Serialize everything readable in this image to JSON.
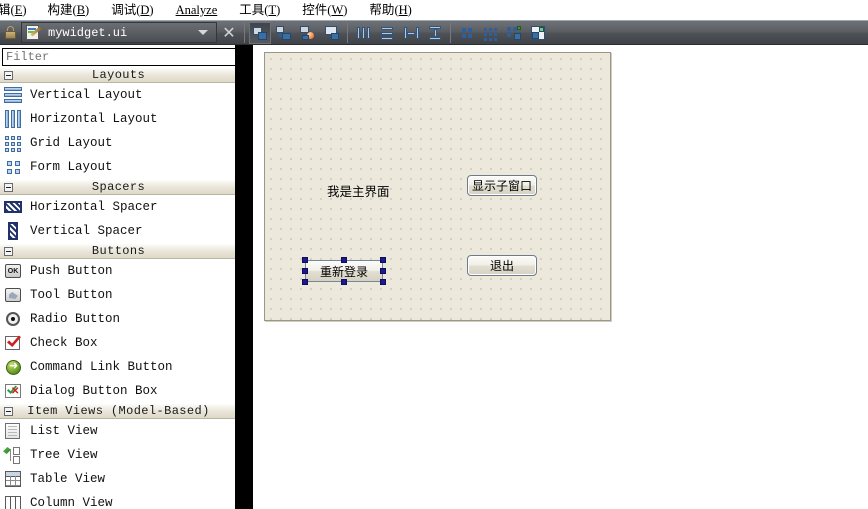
{
  "menu": {
    "items": [
      {
        "label": "辑",
        "mnemonic": "E",
        "name": "menu-edit"
      },
      {
        "label": "构建",
        "mnemonic": "B",
        "name": "menu-build"
      },
      {
        "label": "调试",
        "mnemonic": "D",
        "name": "menu-debug"
      },
      {
        "label": "Analyze",
        "mnemonic": "",
        "name": "menu-analyze"
      },
      {
        "label": "工具",
        "mnemonic": "T",
        "name": "menu-tools"
      },
      {
        "label": "控件",
        "mnemonic": "W",
        "name": "menu-widgets"
      },
      {
        "label": "帮助",
        "mnemonic": "H",
        "name": "menu-help"
      }
    ]
  },
  "toolbar": {
    "lock_icon": "lock-icon",
    "file_name": "mywidget.ui",
    "file_icon": "ui-file-icon",
    "dropdown_icon": "chevron-down-icon",
    "close_label": "✕",
    "buttons": [
      {
        "name": "edit-widgets-button",
        "icon": "edit-widgets-icon",
        "pressed": true
      },
      {
        "name": "edit-signals-slots-button",
        "icon": "edit-signals-slots-icon",
        "pressed": false
      },
      {
        "name": "edit-buddies-button",
        "icon": "edit-buddies-icon",
        "pressed": false
      },
      {
        "name": "edit-tab-order-button",
        "icon": "edit-tab-order-icon",
        "pressed": false
      },
      {
        "name": "layout-horizontally-button",
        "icon": "layout-horizontal-icon",
        "pressed": false
      },
      {
        "name": "layout-vertically-button",
        "icon": "layout-vertical-icon",
        "pressed": false
      },
      {
        "name": "layout-splitter-h-button",
        "icon": "splitter-horizontal-icon",
        "pressed": false
      },
      {
        "name": "layout-splitter-v-button",
        "icon": "splitter-vertical-icon",
        "pressed": false
      },
      {
        "name": "layout-form-button",
        "icon": "form-layout-icon",
        "pressed": false
      },
      {
        "name": "layout-grid-button",
        "icon": "grid-layout-icon",
        "pressed": false
      },
      {
        "name": "break-layout-button",
        "icon": "break-layout-icon",
        "pressed": false
      },
      {
        "name": "adjust-size-button",
        "icon": "adjust-size-icon",
        "pressed": false
      }
    ]
  },
  "widget_box": {
    "filter": {
      "value": "",
      "placeholder": "Filter"
    },
    "sections": [
      {
        "title": "Layouts",
        "expanded": true,
        "items": [
          {
            "label": "Vertical Layout",
            "icon": "vertical-layout-icon"
          },
          {
            "label": "Horizontal Layout",
            "icon": "horizontal-layout-icon"
          },
          {
            "label": "Grid Layout",
            "icon": "grid-layout-icon"
          },
          {
            "label": "Form Layout",
            "icon": "form-layout-icon"
          }
        ]
      },
      {
        "title": "Spacers",
        "expanded": true,
        "items": [
          {
            "label": "Horizontal Spacer",
            "icon": "horizontal-spacer-icon"
          },
          {
            "label": "Vertical Spacer",
            "icon": "vertical-spacer-icon"
          }
        ]
      },
      {
        "title": "Buttons",
        "expanded": true,
        "items": [
          {
            "label": "Push Button",
            "icon": "push-button-icon"
          },
          {
            "label": "Tool Button",
            "icon": "tool-button-icon"
          },
          {
            "label": "Radio Button",
            "icon": "radio-button-icon"
          },
          {
            "label": "Check Box",
            "icon": "check-box-icon"
          },
          {
            "label": "Command Link Button",
            "icon": "command-link-button-icon"
          },
          {
            "label": "Dialog Button Box",
            "icon": "dialog-button-box-icon"
          }
        ]
      },
      {
        "title": "Item Views (Model-Based)",
        "expanded": true,
        "items": [
          {
            "label": "List View",
            "icon": "list-view-icon"
          },
          {
            "label": "Tree View",
            "icon": "tree-view-icon"
          },
          {
            "label": "Table View",
            "icon": "table-view-icon"
          },
          {
            "label": "Column View",
            "icon": "column-view-icon"
          }
        ]
      }
    ]
  },
  "form": {
    "widgets": {
      "main_label": {
        "text": "我是主界面",
        "name": "label-main-window"
      },
      "show_child": {
        "text": "显示子窗口",
        "name": "button-show-child-window"
      },
      "relogin": {
        "text": "重新登录",
        "name": "button-relogin",
        "selected": true
      },
      "quit": {
        "text": "退出",
        "name": "button-quit"
      }
    }
  },
  "colors": {
    "form_background": "#ece9dc",
    "selection_handle": "#1a1a8c",
    "toolbar_background": "#5b5f63",
    "section_header": "#e8e4d8"
  }
}
